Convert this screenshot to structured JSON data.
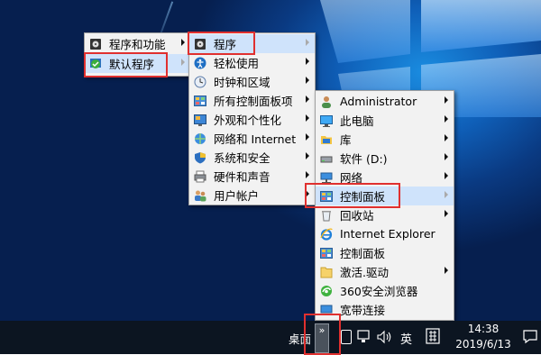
{
  "menu1": {
    "items": [
      {
        "label": "程序和功能",
        "icon": "disc-icon",
        "has_submenu": true
      },
      {
        "label": "默认程序",
        "icon": "default-programs-icon",
        "has_submenu": true
      }
    ]
  },
  "menu2": {
    "items": [
      {
        "label": "程序",
        "icon": "disc-icon",
        "has_submenu": true
      },
      {
        "label": "轻松使用",
        "icon": "ease-of-access-icon",
        "has_submenu": true
      },
      {
        "label": "时钟和区域",
        "icon": "clock-icon",
        "has_submenu": true
      },
      {
        "label": "所有控制面板项",
        "icon": "control-panel-icon",
        "has_submenu": true
      },
      {
        "label": "外观和个性化",
        "icon": "appearance-icon",
        "has_submenu": true
      },
      {
        "label": "网络和 Internet",
        "icon": "network-icon",
        "has_submenu": true
      },
      {
        "label": "系统和安全",
        "icon": "security-shield-icon",
        "has_submenu": true
      },
      {
        "label": "硬件和声音",
        "icon": "printer-icon",
        "has_submenu": true
      },
      {
        "label": "用户帐户",
        "icon": "users-icon",
        "has_submenu": true
      }
    ]
  },
  "menu3": {
    "items": [
      {
        "label": "Administrator",
        "icon": "user-icon",
        "has_submenu": true
      },
      {
        "label": "此电脑",
        "icon": "computer-icon",
        "has_submenu": true
      },
      {
        "label": "库",
        "icon": "library-folder-icon",
        "has_submenu": true
      },
      {
        "label": "软件 (D:)",
        "icon": "drive-icon",
        "has_submenu": true
      },
      {
        "label": "网络",
        "icon": "network-drive-icon",
        "has_submenu": true
      },
      {
        "label": "控制面板",
        "icon": "control-panel-icon",
        "has_submenu": true
      },
      {
        "label": "回收站",
        "icon": "recycle-bin-icon",
        "has_submenu": true
      },
      {
        "label": "Internet Explorer",
        "icon": "ie-icon",
        "has_submenu": false
      },
      {
        "label": "控制面板",
        "icon": "control-panel-icon",
        "has_submenu": false
      },
      {
        "label": "激活.驱动",
        "icon": "folder-icon",
        "has_submenu": true
      },
      {
        "label": "360安全浏览器",
        "icon": "browser-360-icon",
        "has_submenu": false
      },
      {
        "label": "宽带连接",
        "icon": "broadband-icon",
        "has_submenu": false
      }
    ]
  },
  "taskbar": {
    "desktop_label": "桌面",
    "toolbar_expand": "»",
    "ime_label": "英",
    "time": "14:38",
    "date": "2019/6/13"
  }
}
